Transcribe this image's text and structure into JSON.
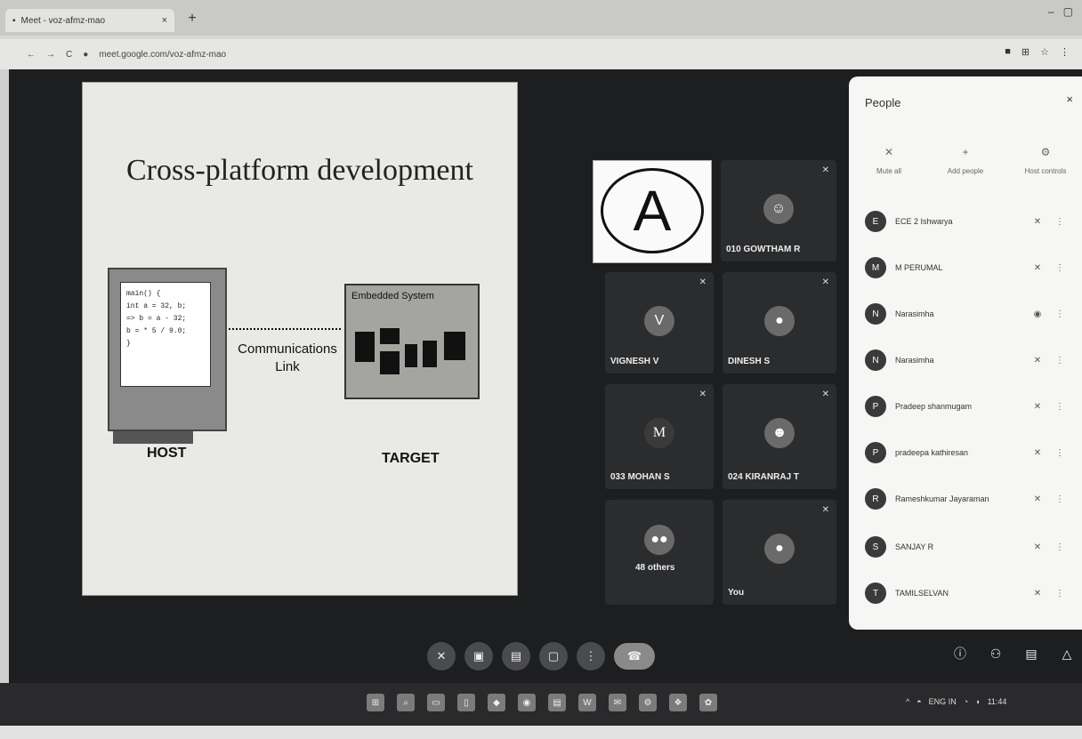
{
  "browser": {
    "tab_title": "Meet - voz-afmz-mao",
    "tab_close": "×",
    "new_tab": "+",
    "url": "meet.google.com/voz-afmz-mao",
    "nav_back": "←",
    "nav_forward": "→",
    "nav_reload": "C",
    "lock": "●"
  },
  "slide": {
    "title": "Cross-platform development",
    "code_lines": [
      "main() {",
      "  int a = 32, b;",
      "=> b = a - 32;",
      "  b = * 5 / 9.0;",
      "}"
    ],
    "host_label": "HOST",
    "link_label": "Communications Link",
    "target_box_title": "Embedded System",
    "target_label": "TARGET"
  },
  "tiles": {
    "a_letter": "A",
    "gowtham": "010 GOWTHAM R",
    "vignesh": "VIGNESH V",
    "vignesh_initial": "V",
    "dinesh": "DINESH S",
    "mohan": "033 MOHAN S",
    "mohan_initial": "M",
    "kiranraj": "024 KIRANRAJ T",
    "others": "48 others",
    "you": "You"
  },
  "people": {
    "title": "People",
    "close": "×",
    "actions": [
      "Mute all",
      "Add people",
      "Host controls"
    ],
    "rows": [
      {
        "initial": "E",
        "name": "ECE 2 Ishwarya"
      },
      {
        "initial": "M",
        "name": "M PERUMAL"
      },
      {
        "initial": "N",
        "name": "Narasimha"
      },
      {
        "initial": "N",
        "name": "Narasimha"
      },
      {
        "initial": "P",
        "name": "Pradeep shanmugam"
      },
      {
        "initial": "P",
        "name": "pradeepa kathiresan"
      },
      {
        "initial": "R",
        "name": "Rameshkumar Jayaraman"
      },
      {
        "initial": "S",
        "name": "SANJAY R"
      },
      {
        "initial": "T",
        "name": "TAMILSELVAN"
      }
    ]
  },
  "tray": {
    "lang": "ENG",
    "region": "IN",
    "time": "11:44"
  }
}
